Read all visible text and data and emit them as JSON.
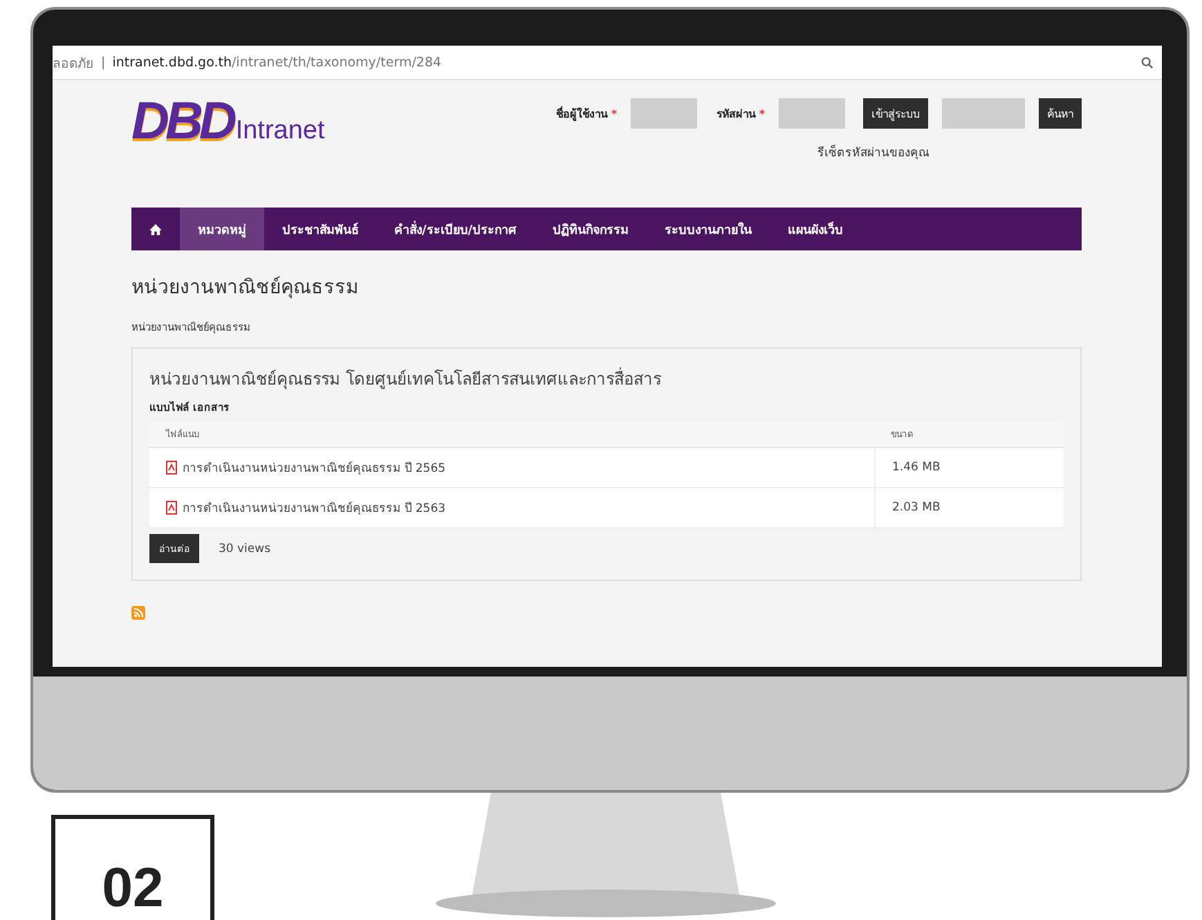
{
  "address_bar": {
    "security": "ลอดภัย",
    "separator": "|",
    "host": "intranet.dbd.go.th",
    "path": "/intranet/th/taxonomy/term/284"
  },
  "header": {
    "logo": "DBD",
    "logo_suffix": "Intranet",
    "login": {
      "username_label": "ชื่อผู้ใช้งาน",
      "password_label": "รหัสผ่าน",
      "required_mark": "*",
      "login_button": "เข้าสู่ระบบ",
      "search_button": "ค้นหา",
      "reset_link": "รีเซ็ตรหัสผ่านของคุณ"
    }
  },
  "nav": [
    {
      "label": "หมวดหมู่",
      "selected": true
    },
    {
      "label": "ประชาสัมพันธ์",
      "selected": false
    },
    {
      "label": "คำสั่ง/ระเบียบ/ประกาศ",
      "selected": false
    },
    {
      "label": "ปฏิทินกิจกรรม",
      "selected": false
    },
    {
      "label": "ระบบงานภายใน",
      "selected": false
    },
    {
      "label": "แผนผังเว็บ",
      "selected": false
    }
  ],
  "page_title": "หน่วยงานพาณิชย์คุณธรรม",
  "breadcrumb": "หน่วยงานพาณิชย์คุณธรรม",
  "card": {
    "title": "หน่วยงานพาณิชย์คุณธรรม โดยศูนย์เทคโนโลยีสารสนเทศและการสื่อสาร",
    "section": "แบบไฟล์ เอกสาร",
    "columns": [
      "ไฟล์แนบ",
      "ขนาด"
    ],
    "rows": [
      {
        "file": "การดำเนินงานหน่วยงานพาณิชย์คุณธรรม ปี 2565",
        "size": "1.46 MB"
      },
      {
        "file": "การดำเนินงานหน่วยงานพาณิชย์คุณธรรม ปี 2563",
        "size": "2.03 MB"
      }
    ],
    "read_more": "อ่านต่อ",
    "views": "30 views"
  },
  "badge": "02"
}
